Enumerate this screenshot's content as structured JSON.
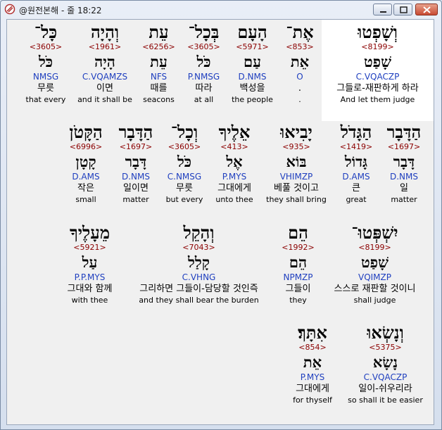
{
  "window": {
    "title": "@원전본해 - 줄 18:22"
  },
  "rows": [
    [
      {
        "hebrew": "וְשָׁפְטוּ",
        "strong": "<8199>",
        "lemma": "שָׁפַט",
        "morph": "C.VQACZP",
        "korean": "그들로-재판하게 하라",
        "english": "And let them judge"
      },
      {
        "hebrew": "אֶת־",
        "strong": "<853>",
        "lemma": "אֵת",
        "morph": "O",
        "korean": ".",
        "english": "."
      },
      {
        "hebrew": "הָעָם",
        "strong": "<5971>",
        "lemma": "עַם",
        "morph": "D.NMS",
        "korean": "백성을",
        "english": "the people"
      },
      {
        "hebrew": "בְּכָל־",
        "strong": "<3605>",
        "lemma": "כֹּל",
        "morph": "P.NMSG",
        "korean": "따라",
        "english": "at all"
      },
      {
        "hebrew": "עֵת",
        "strong": "<6256>",
        "lemma": "עֵת",
        "morph": "NFS",
        "korean": "때를",
        "english": "seacons"
      },
      {
        "hebrew": "וְהָיָה",
        "strong": "<1961>",
        "lemma": "הָיָה",
        "morph": "C.VQAMZS",
        "korean": "이면",
        "english": "and it shall be"
      },
      {
        "hebrew": "כָּל־",
        "strong": "<3605>",
        "lemma": "כֹּל",
        "morph": "NMSG",
        "korean": "무릇",
        "english": "that every"
      }
    ],
    [
      {
        "hebrew": "הַדָּבָר",
        "strong": "<1697>",
        "lemma": "דָּבָר",
        "morph": "D.NMS",
        "korean": "일",
        "english": "matter"
      },
      {
        "hebrew": "הַגָּדֹל",
        "strong": "<1419>",
        "lemma": "גָּדוֹל",
        "morph": "D.AMS",
        "korean": "큰",
        "english": "great"
      },
      {
        "hebrew": "יָבִיאוּ",
        "strong": "<935>",
        "lemma": "בּוֹא",
        "morph": "VHIMZP",
        "korean": "베풀 것이고",
        "english": "they shall bring"
      },
      {
        "hebrew": "אֵלֶיךָ",
        "strong": "<413>",
        "lemma": "אֶל",
        "morph": "P.MYS",
        "korean": "그대에게",
        "english": "unto thee"
      },
      {
        "hebrew": "וְכָל־",
        "strong": "<3605>",
        "lemma": "כֹּל",
        "morph": "C.NMSG",
        "korean": "무릇",
        "english": "but every"
      },
      {
        "hebrew": "הַדָּבָר",
        "strong": "<1697>",
        "lemma": "דָּבָר",
        "morph": "D.NMS",
        "korean": "일이면",
        "english": "matter"
      },
      {
        "hebrew": "הַקָּטֹן",
        "strong": "<6996>",
        "lemma": "קָטָן",
        "morph": "D.AMS",
        "korean": "작은",
        "english": "small"
      }
    ],
    [
      {
        "hebrew": "יִשְׁפְּטוּ־",
        "strong": "<8199>",
        "lemma": "שָׁפַט",
        "morph": "VQIMZP",
        "korean": "스스로 재판할 것이니",
        "english": "shall judge"
      },
      {
        "hebrew": "הֵם",
        "strong": "<1992>",
        "lemma": "הֵם",
        "morph": "NPMZP",
        "korean": "그들이",
        "english": "they"
      },
      {
        "hebrew": "וְהָקֵל",
        "strong": "<7043>",
        "lemma": "קָלַל",
        "morph": "C.VHNG",
        "korean": "그리하면 그들이-담당할 것인즉",
        "english": "and they shall bear the burden"
      },
      {
        "hebrew": "מֵעָלֶיךָ",
        "strong": "<5921>",
        "lemma": "עַל",
        "morph": "P.P.MYS",
        "korean": "그대와 함께",
        "english": "with thee"
      }
    ],
    [
      {
        "hebrew": "וְנָשְׂאוּ",
        "strong": "<5375>",
        "lemma": "נָשָׂא",
        "morph": "C.VQACZP",
        "korean": "일이-쉬우리라",
        "english": "so shall it be easier"
      },
      {
        "hebrew": "אִתָּךְ׃",
        "strong": "<854>",
        "lemma": "אֵת",
        "morph": "P.MYS",
        "korean": "그대에게",
        "english": "for thyself"
      }
    ]
  ]
}
